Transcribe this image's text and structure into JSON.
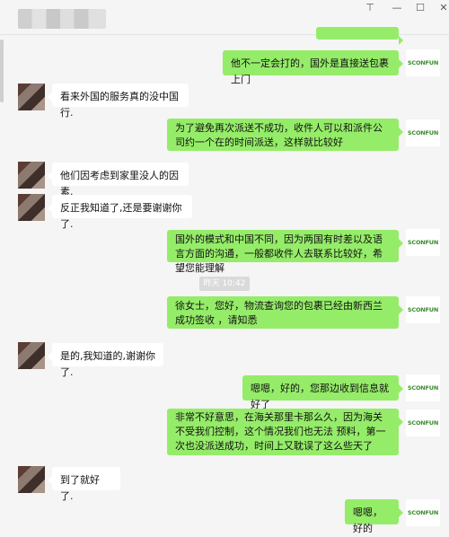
{
  "window": {
    "pin_glyph": "⊤",
    "minimize_glyph": "—",
    "maximize_glyph": "☐",
    "close_glyph": "✕"
  },
  "contact_avatar_icon": "blurred-contact-avatar",
  "my_avatar_text": "SCONFUN",
  "colors": {
    "out_bubble": "#95ec69",
    "in_bubble": "#ffffff",
    "background": "#f5f5f5"
  },
  "timestamp": "昨天 10:42",
  "messages": [
    {
      "dir": "out",
      "text": "他不一定会打的，国外是直接送包裹上门"
    },
    {
      "dir": "in",
      "text": "看来外国的服务真的没中国行."
    },
    {
      "dir": "out",
      "text": "为了避免再次派送不成功，收件人可以和派件公司约一个在的时间派送，这样就比较好"
    },
    {
      "dir": "in",
      "text": "他们因考虑到家里没人的因素."
    },
    {
      "dir": "in",
      "text": "反正我知道了,还是要谢谢你了."
    },
    {
      "dir": "out",
      "text": "国外的模式和中国不同，因为两国有时差以及语言方面的沟通，一般都收件人去联系比较好，希望您能理解"
    },
    {
      "dir": "out",
      "text": "徐女士，您好，物流查询您的包裹已经由新西兰成功签收 ，请知悉"
    },
    {
      "dir": "in",
      "text": "是的,我知道的,谢谢你了."
    },
    {
      "dir": "out",
      "text": "嗯嗯，好的，您那边收到信息就好了"
    },
    {
      "dir": "out",
      "text": "非常不好意思，在海关那里卡那么久，因为海关不受我们控制，这个情况我们也无法 预料，第一次也没派送成功，时间上又耽误了这么些天了"
    },
    {
      "dir": "in",
      "text": "到了就好了."
    },
    {
      "dir": "out",
      "text": "嗯嗯，好的"
    }
  ]
}
